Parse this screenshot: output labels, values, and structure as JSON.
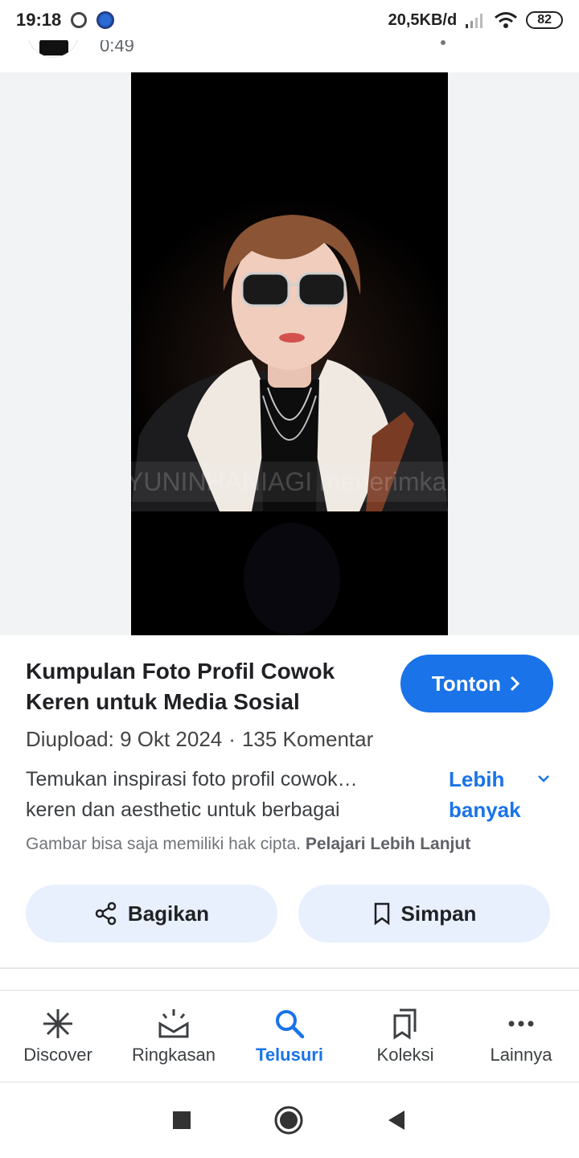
{
  "status_bar": {
    "time": "19:18",
    "network_speed": "20,5KB/d",
    "battery": "82"
  },
  "previous_item": {
    "duration": "0:49"
  },
  "media": {
    "overlay_text": "AYUNINHANIAGI menerimkan."
  },
  "result": {
    "title": "Kumpulan Foto Profil Cowok Keren untuk Media Sosial",
    "watch_label": "Tonton",
    "uploaded": "Diupload: 9 Okt 2024",
    "separator": "·",
    "comments": "135 Komentar",
    "description_line1": "Temukan inspirasi foto profil cowok…",
    "description_line2": "keren dan aesthetic untuk berbagai",
    "more_label": "Lebih banyak",
    "copyright_notice": "Gambar bisa saja memiliki hak cipta.",
    "learn_more": "Pelajari Lebih Lanjut",
    "share_label": "Bagikan",
    "save_label": "Simpan"
  },
  "bottom_nav": {
    "items": [
      {
        "label": "Discover",
        "icon": "asterisk-icon"
      },
      {
        "label": "Ringkasan",
        "icon": "sunrise-icon"
      },
      {
        "label": "Telusuri",
        "icon": "search-icon",
        "active": true
      },
      {
        "label": "Koleksi",
        "icon": "bookmarks-icon"
      },
      {
        "label": "Lainnya",
        "icon": "more-dots-icon"
      }
    ]
  },
  "colors": {
    "accent": "#1a73e8",
    "chip_bg": "#e8f0fe",
    "media_bg": "#f1f3f4"
  }
}
